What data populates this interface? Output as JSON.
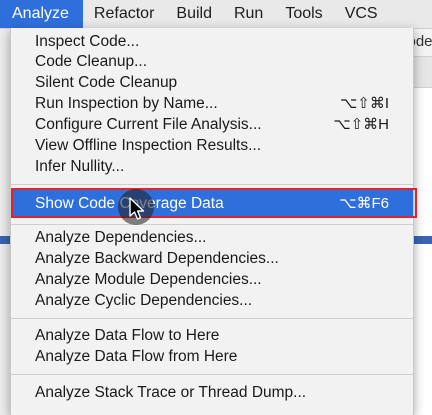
{
  "menubar": {
    "items": [
      {
        "label": "Analyze"
      },
      {
        "label": "Refactor"
      },
      {
        "label": "Build"
      },
      {
        "label": "Run"
      },
      {
        "label": "Tools"
      },
      {
        "label": "VCS"
      }
    ]
  },
  "background": {
    "tab_text": "code"
  },
  "menu": {
    "group1": [
      {
        "label": "Inspect Code..."
      },
      {
        "label": "Code Cleanup..."
      },
      {
        "label": "Silent Code Cleanup"
      },
      {
        "label": "Run Inspection by Name...",
        "shortcut": "⌥⇧⌘I"
      },
      {
        "label": "Configure Current File Analysis...",
        "shortcut": "⌥⇧⌘H"
      },
      {
        "label": "View Offline Inspection Results..."
      },
      {
        "label": "Infer Nullity..."
      }
    ],
    "highlighted": {
      "label": "Show Code Coverage Data",
      "shortcut": "⌥⌘F6"
    },
    "group2": [
      {
        "label": "Analyze Dependencies..."
      },
      {
        "label": "Analyze Backward Dependencies..."
      },
      {
        "label": "Analyze Module Dependencies..."
      },
      {
        "label": "Analyze Cyclic Dependencies..."
      }
    ],
    "group3": [
      {
        "label": "Analyze Data Flow to Here"
      },
      {
        "label": "Analyze Data Flow from Here"
      }
    ],
    "group4": [
      {
        "label": "Analyze Stack Trace or Thread Dump..."
      }
    ]
  },
  "colors": {
    "accent": "#2f6fdc",
    "annotation": "#e0242a"
  }
}
